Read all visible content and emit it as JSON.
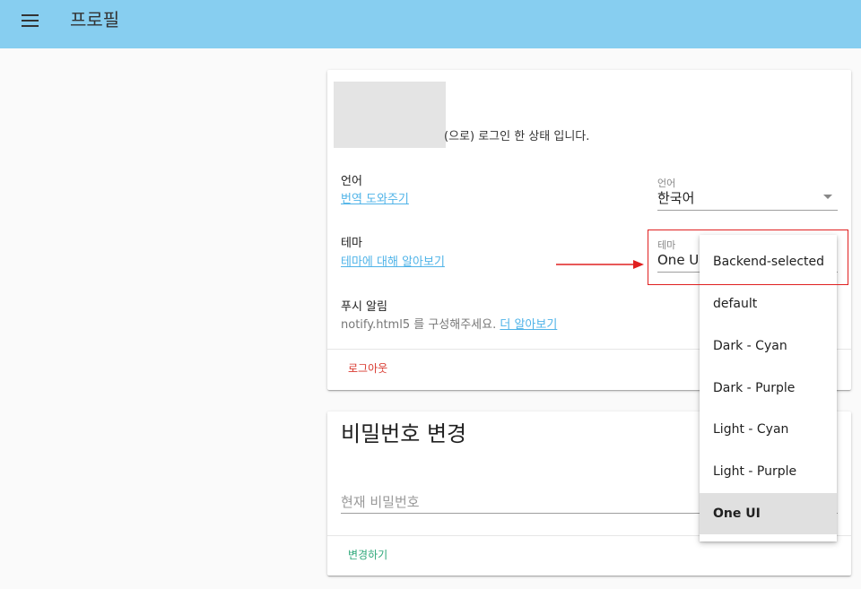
{
  "toolbar": {
    "title": "프로필",
    "menu_icon": "hamburger-menu-icon",
    "background": "#87cef0"
  },
  "profile": {
    "login_state": "(으로) 로그인 한 상태 입니다.",
    "language": {
      "label": "언어",
      "link": "번역 도와주기",
      "select_label": "언어",
      "select_value": "한국어"
    },
    "theme": {
      "label": "테마",
      "link": "테마에 대해 알아보기",
      "select_label": "테마",
      "select_value": "One UI"
    },
    "push": {
      "label": "푸시 알림",
      "hint": "notify.html5 를 구성해주세요.",
      "hint_link": "더 알아보기"
    },
    "logout": "로그아웃"
  },
  "password": {
    "title": "비밀번호 변경",
    "current_placeholder": "현재 비밀번호",
    "submit": "변경하기"
  },
  "theme_dropdown": {
    "options": [
      "Backend-selected",
      "default",
      "Dark - Cyan",
      "Dark - Purple",
      "Light - Cyan",
      "Light - Purple",
      "One UI"
    ],
    "selected": "One UI"
  },
  "colors": {
    "link": "#4fb3e8",
    "logout": "#d9392f",
    "submit": "#2ea87a",
    "annotation": "#e02020"
  }
}
